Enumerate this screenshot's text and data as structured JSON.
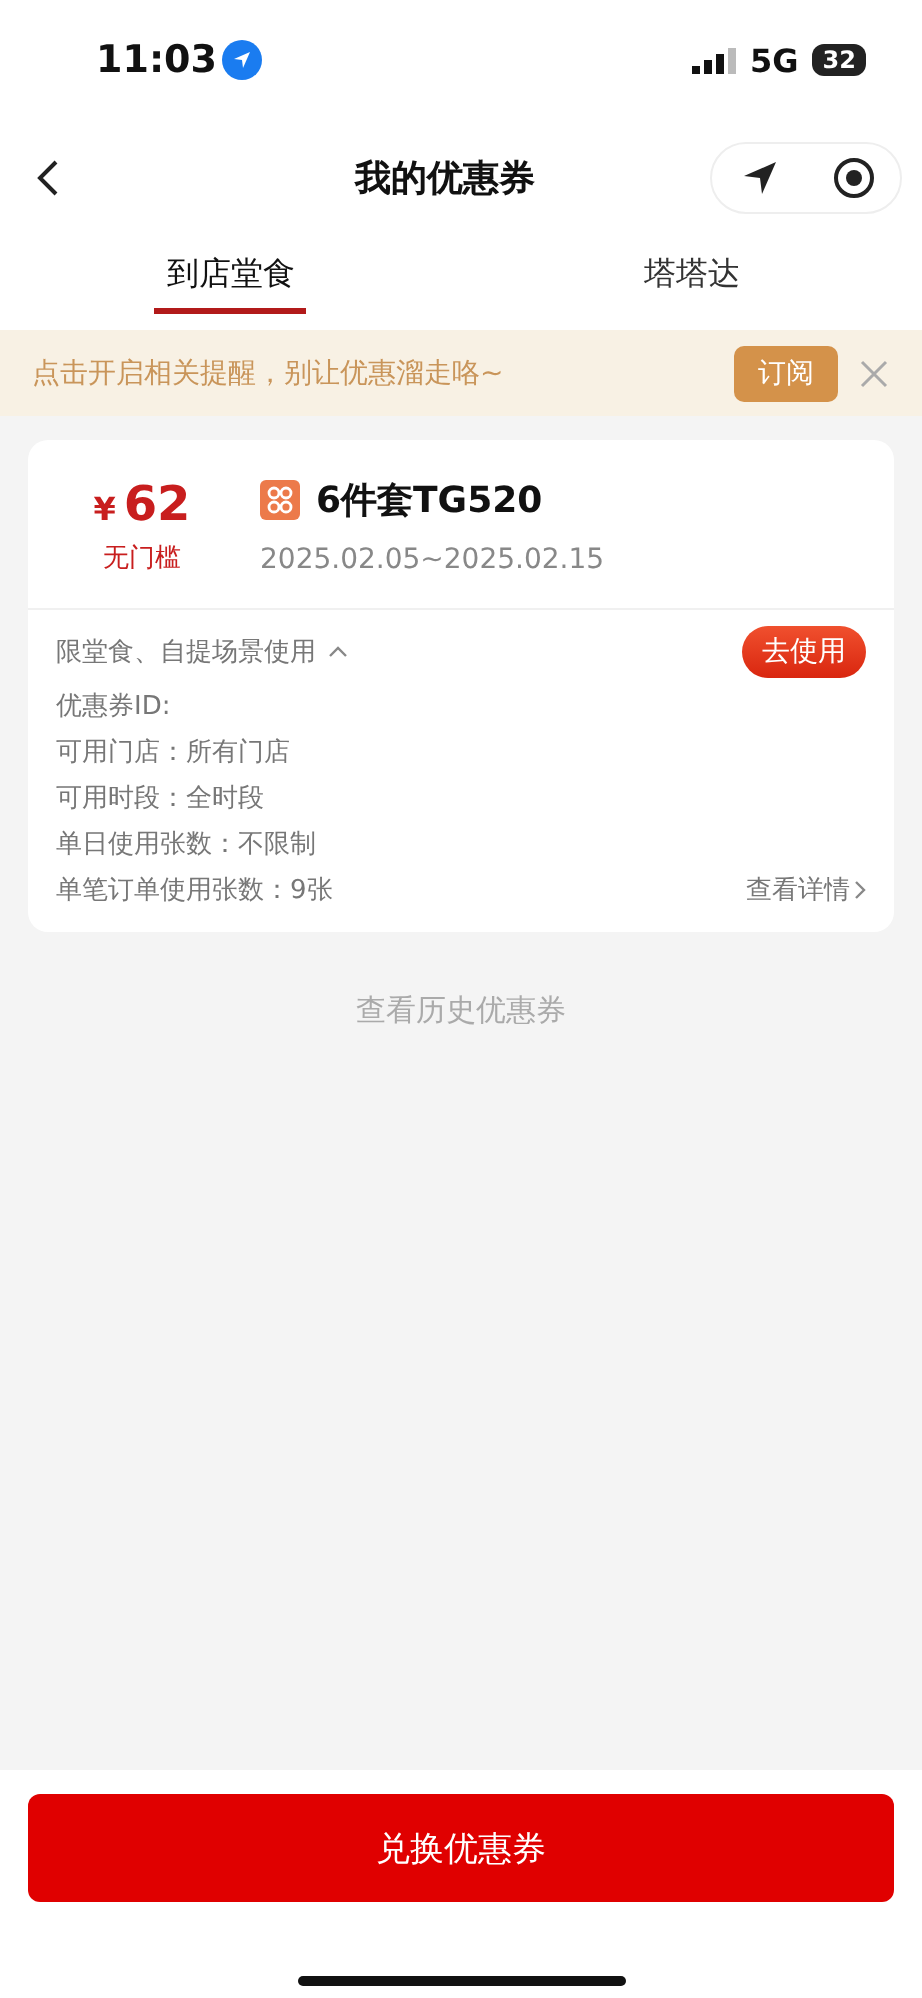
{
  "status_bar": {
    "time": "11:03",
    "network": "5G",
    "battery": "32"
  },
  "nav": {
    "title": "我的优惠券"
  },
  "tabs": [
    {
      "label": "到店堂食",
      "selected": true
    },
    {
      "label": "塔塔达",
      "selected": false
    }
  ],
  "notice": {
    "text": "点击开启相关提醒，别让优惠溜走咯~",
    "button": "订阅"
  },
  "coupons": [
    {
      "currency": "¥",
      "amount": "62",
      "threshold": "无门槛",
      "name": "6件套TG520",
      "validity": "2025.02.05~2025.02.15",
      "scope": "限堂食、自提场景使用",
      "expanded": true,
      "action": "去使用",
      "details": [
        "优惠券ID:",
        "可用门店：所有门店",
        "可用时段：全时段",
        "单日使用张数：不限制",
        "单笔订单使用张数：9张"
      ],
      "detail_link": "查看详情"
    }
  ],
  "history_link": "查看历史优惠券",
  "footer_button": "兑换优惠券"
}
